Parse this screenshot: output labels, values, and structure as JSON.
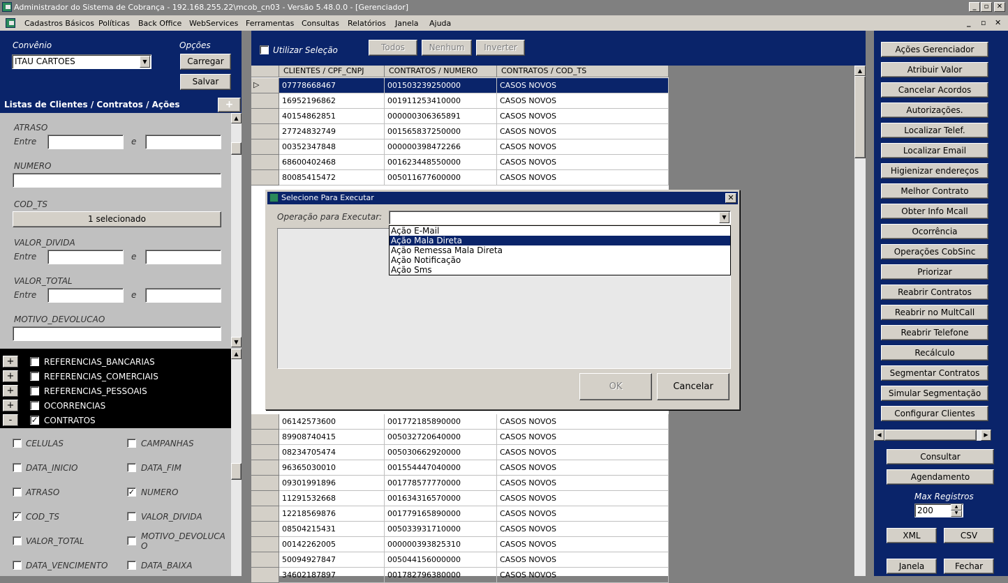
{
  "window": {
    "title": "Administrador do Sistema de Cobrança - 192.168.255.22\\mcob_cn03 - Versão 5.48.0.0 - [Gerenciador]",
    "btn_min": "_",
    "btn_max": "▫",
    "btn_close": "✕"
  },
  "menu": {
    "items": [
      "Cadastros Básicos",
      "Políticas",
      "Back Office",
      "WebServices",
      "Ferramentas",
      "Consultas",
      "Relatórios",
      "Janela",
      "Ajuda"
    ],
    "mdi_min": "_",
    "mdi_restore": "▫",
    "mdi_close": "✕"
  },
  "left": {
    "convenio_label": "Convênio",
    "convenio_value": "ITAU CARTOES",
    "opcoes_label": "Opções",
    "carregar": "Carregar",
    "salvar": "Salvar",
    "section_title": "Listas de Clientes / Contratos / Ações",
    "section_add": "+",
    "filters": {
      "atraso": "ATRASO",
      "entre": "Entre",
      "e": "e",
      "numero": "NUMERO",
      "cod_ts": "COD_TS",
      "cod_ts_btn": "1 selecionado",
      "valor_divida": "VALOR_DIVIDA",
      "valor_total": "VALOR_TOTAL",
      "motivo": "MOTIVO_DEVOLUCAO"
    },
    "tree": [
      {
        "sign": "+",
        "label": "REFERENCIAS_BANCARIAS",
        "checked": false
      },
      {
        "sign": "+",
        "label": "REFERENCIAS_COMERCIAIS",
        "checked": false
      },
      {
        "sign": "+",
        "label": "REFERENCIAS_PESSOAIS",
        "checked": false
      },
      {
        "sign": "+",
        "label": "OCORRENCIAS",
        "checked": false
      },
      {
        "sign": "-",
        "label": "CONTRATOS",
        "checked": true
      }
    ],
    "fields": [
      {
        "label": "CELULAS",
        "checked": false
      },
      {
        "label": "CAMPANHAS",
        "checked": false
      },
      {
        "label": "DATA_INICIO",
        "checked": false
      },
      {
        "label": "DATA_FIM",
        "checked": false
      },
      {
        "label": "ATRASO",
        "checked": false
      },
      {
        "label": "NUMERO",
        "checked": true
      },
      {
        "label": "COD_TS",
        "checked": true
      },
      {
        "label": "VALOR_DIVIDA",
        "checked": false
      },
      {
        "label": "VALOR_TOTAL",
        "checked": false
      },
      {
        "label": "MOTIVO_DEVOLUCA O",
        "checked": false
      },
      {
        "label": "DATA_VENCIMENTO",
        "checked": false
      },
      {
        "label": "DATA_BAIXA",
        "checked": false
      }
    ]
  },
  "center": {
    "utilizar_selecao": "Utilizar Seleção",
    "todos": "Todos",
    "nenhum": "Nenhum",
    "inverter": "Inverter",
    "columns": [
      "CLIENTES / CPF_CNPJ",
      "CONTRATOS / NUMERO",
      "CONTRATOS / COD_TS"
    ],
    "rows_top": [
      [
        "07778668467",
        "001503239250000",
        "CASOS NOVOS"
      ],
      [
        "16952196862",
        "001911253410000",
        "CASOS NOVOS"
      ],
      [
        "40154862851",
        "000000306365891",
        "CASOS NOVOS"
      ],
      [
        "27724832749",
        "001565837250000",
        "CASOS NOVOS"
      ],
      [
        "00352347848",
        "000000398472266",
        "CASOS NOVOS"
      ],
      [
        "68600402468",
        "001623448550000",
        "CASOS NOVOS"
      ],
      [
        "80085415472",
        "005011677600000",
        "CASOS NOVOS"
      ]
    ],
    "rows_bottom": [
      [
        "06142573600",
        "001772185890000",
        "CASOS NOVOS"
      ],
      [
        "89908740415",
        "005032720640000",
        "CASOS NOVOS"
      ],
      [
        "08234705474",
        "005030662920000",
        "CASOS NOVOS"
      ],
      [
        "96365030010",
        "001554447040000",
        "CASOS NOVOS"
      ],
      [
        "09301991896",
        "001778577770000",
        "CASOS NOVOS"
      ],
      [
        "11291532668",
        "001634316570000",
        "CASOS NOVOS"
      ],
      [
        "12218569876",
        "001779165890000",
        "CASOS NOVOS"
      ],
      [
        "08504215431",
        "005033931710000",
        "CASOS NOVOS"
      ],
      [
        "00142262005",
        "000000393825310",
        "CASOS NOVOS"
      ],
      [
        "50094927847",
        "005044156000000",
        "CASOS NOVOS"
      ],
      [
        "34602187897",
        "001782796380000",
        "CASOS NOVOS"
      ]
    ]
  },
  "right": {
    "buttons": [
      "Ações Gerenciador",
      "Atribuir Valor",
      "Cancelar Acordos",
      "Autorizações.",
      "Localizar Telef.",
      "Localizar Email",
      "Higienizar endereços",
      "Melhor Contrato",
      "Obter Info Mcall",
      "Ocorrência",
      "Operações CobSinc",
      "Priorizar",
      "Reabrir Contratos",
      "Reabrir no MultCall",
      "Reabrir Telefone",
      "Recálculo",
      "Segmentar Contratos",
      "Simular Segmentação",
      "Configurar Clientes"
    ],
    "consultar": "Consultar",
    "agendamento": "Agendamento",
    "max_registros_label": "Max Registros",
    "max_registros_value": "200",
    "xml": "XML",
    "csv": "CSV",
    "janela": "Janela",
    "fechar": "Fechar"
  },
  "dialog": {
    "title": "Selecione  Para Executar",
    "close": "✕",
    "label": "Operação para Executar:",
    "options": [
      "Ação E-Mail",
      "Ação Mala Direta",
      "Ação Remessa Mala Direta",
      "Ação Notificação",
      "Ação Sms"
    ],
    "highlighted": "Ação Mala Direta",
    "ok": "OK",
    "cancelar": "Cancelar"
  },
  "colors": {
    "navy": "#0a246a",
    "face": "#d4d0c8",
    "workspace": "#808080"
  }
}
